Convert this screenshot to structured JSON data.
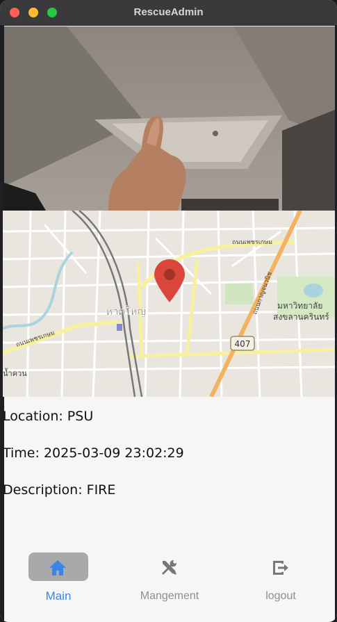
{
  "window": {
    "title": "RescueAdmin"
  },
  "info": {
    "location": "Location: PSU",
    "time": "Time: 2025-03-09 23:02:29",
    "description": "Description: FIRE"
  },
  "map": {
    "labels": {
      "road_north": "ถนนเพชรเกษม",
      "road_west": "ถนนเพชรเกษม",
      "district": "หาดใหญ่",
      "university_line1": "มหาวิทยาลัย",
      "university_line2": "สงขลานครินทร์",
      "highway_shield": "407",
      "road_east": "ถนนกาญจนวนิช",
      "edge_left": "น้ำควน"
    },
    "marker_icon": "map-pin-icon"
  },
  "nav": {
    "items": [
      {
        "label": "Main",
        "icon": "home-icon",
        "active": true
      },
      {
        "label": "Mangement",
        "icon": "tools-icon",
        "active": false
      },
      {
        "label": "logout",
        "icon": "logout-icon",
        "active": false
      }
    ]
  },
  "colors": {
    "accent": "#3a86e6",
    "active_pill": "#a8a9ab",
    "inactive": "#8e8e8e",
    "marker": "#d9473c"
  }
}
